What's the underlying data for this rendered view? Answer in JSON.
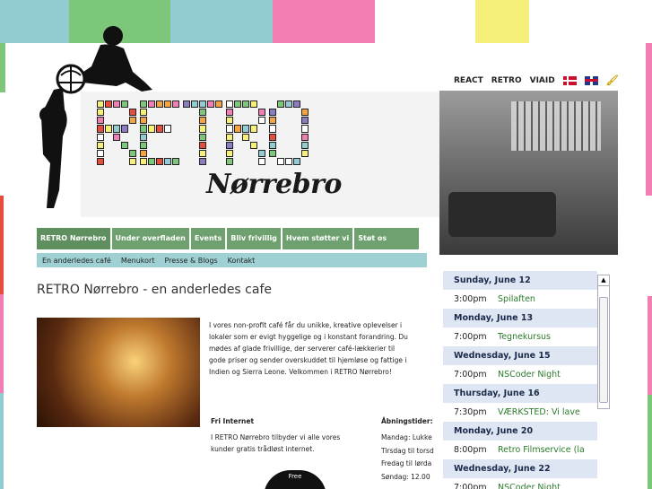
{
  "top_nav": {
    "links": [
      "REACT",
      "RETRO",
      "VIAID"
    ],
    "icons": [
      "danish-flag-icon",
      "uk-flag-icon",
      "paintbrush-icon"
    ]
  },
  "logo": {
    "title": "RETRO",
    "subtitle": "Nørrebro"
  },
  "main_menu": [
    "RETRO Nørrebro",
    "Under overfladen",
    "Events",
    "Bliv frivillig",
    "Hvem støtter vi",
    "Støt os"
  ],
  "sub_menu": [
    "En anderledes café",
    "Menukort",
    "Presse & Blogs",
    "Kontakt"
  ],
  "page_title": "RETRO Nørrebro - en anderledes cafe",
  "intro_text": "I vores non-profit café får du unikke, kreative oplevelser i lokaler som er evigt hyggelige og i konstant forandring. Du mødes af glade frivillige, der serverer café-lækkerier til gode priser og sender overskuddet til hjemløse og fattige i Indien og Sierra Leone. Velkommen i RETRO Nørrebro!",
  "wifi": {
    "title": "Fri Internet",
    "text": "I RETRO Nørrebro tilbyder vi alle vores kunder gratis trådløst internet.",
    "logo_text": "Free"
  },
  "hours": {
    "title": "Åbningstider:",
    "lines": [
      "Mandag: Lukke",
      "Tirsdag til torsd",
      "Fredag til lørda",
      "Søndag: 12.00"
    ]
  },
  "calendar": [
    {
      "day": "Sunday, June 12",
      "events": [
        {
          "time": "3:00pm",
          "name": "Spilaften"
        }
      ]
    },
    {
      "day": "Monday, June 13",
      "events": [
        {
          "time": "7:00pm",
          "name": "Tegnekursus"
        }
      ]
    },
    {
      "day": "Wednesday, June 15",
      "events": [
        {
          "time": "7:00pm",
          "name": "NSCoder Night"
        }
      ]
    },
    {
      "day": "Thursday, June 16",
      "events": [
        {
          "time": "7:30pm",
          "name": "VÆRKSTED: Vi lave"
        }
      ]
    },
    {
      "day": "Monday, June 20",
      "events": [
        {
          "time": "8:00pm",
          "name": "Retro Filmservice (la"
        }
      ]
    },
    {
      "day": "Wednesday, June 22",
      "events": [
        {
          "time": "7:00pm",
          "name": "NSCoder Night"
        }
      ]
    }
  ],
  "colors": {
    "menu_green": "#6fa06f",
    "submenu_teal": "#9fd0d4",
    "event_green": "#2c7a2c",
    "day_header": "#dfe6f3"
  }
}
